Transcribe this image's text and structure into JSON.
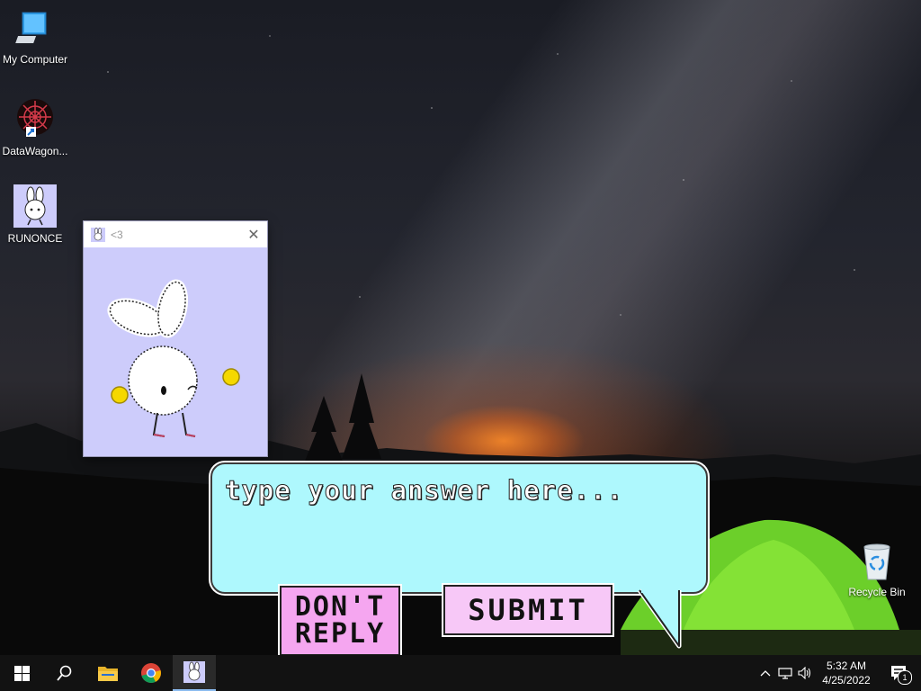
{
  "desktop": {
    "icons": [
      {
        "label": "My Computer"
      },
      {
        "label": "DataWagon..."
      },
      {
        "label": "RUNONCE"
      },
      {
        "label": "Recycle Bin"
      }
    ]
  },
  "window": {
    "title": "<3",
    "close_glyph": "✕"
  },
  "dialog": {
    "answer_placeholder": "type your answer here...",
    "dont_reply_line1": "DON'T",
    "dont_reply_line2": "REPLY",
    "submit_label": "SUBMIT"
  },
  "taskbar": {
    "icons": [
      "windows-start-icon",
      "search-icon",
      "file-explorer-icon",
      "chrome-icon",
      "bunny-app-icon"
    ],
    "clock_time": "5:32 AM",
    "clock_date": "4/25/2022",
    "notification_count": "1"
  },
  "colors": {
    "window_bg": "#cdccfb",
    "answer_bg": "#aef8fd",
    "dont_reply_bg": "#f5a6f0",
    "submit_bg": "#f7c8f7",
    "taskbar_bg": "#121212"
  }
}
